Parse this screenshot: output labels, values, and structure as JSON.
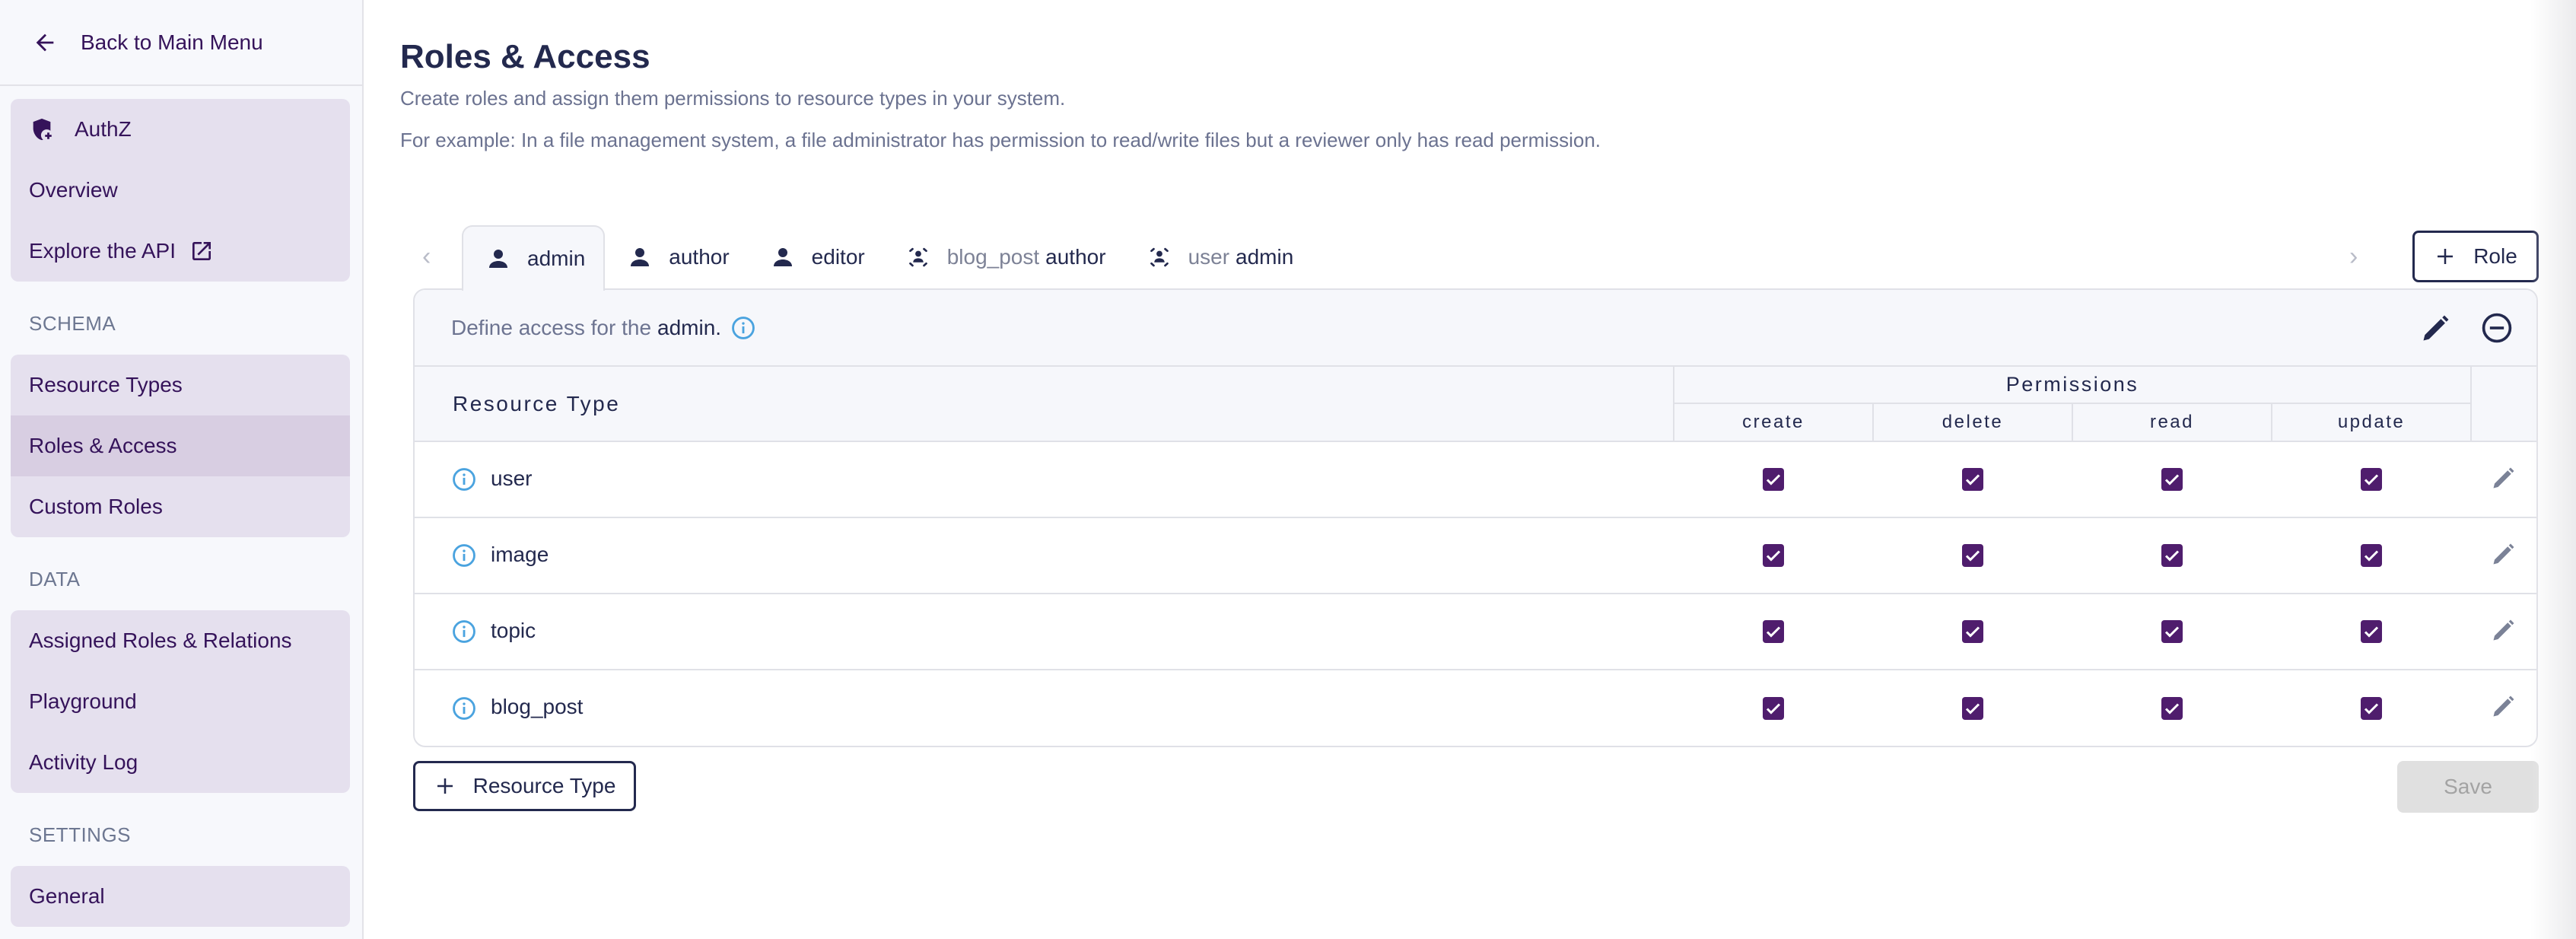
{
  "sidebar": {
    "back_label": "Back to Main Menu",
    "product": {
      "title": "AuthZ",
      "items": [
        "Overview",
        "Explore the API"
      ]
    },
    "sections": [
      {
        "label": "SCHEMA",
        "items": [
          "Resource Types",
          "Roles & Access",
          "Custom Roles"
        ],
        "active": "Roles & Access"
      },
      {
        "label": "DATA",
        "items": [
          "Assigned Roles & Relations",
          "Playground",
          "Activity Log"
        ]
      },
      {
        "label": "SETTINGS",
        "items": [
          "General"
        ]
      }
    ]
  },
  "header": {
    "title": "Roles & Access",
    "subtitle": "Create roles and assign them permissions to resource types in your system.",
    "example": "For example: In a file management system, a file administrator has permission to read/write files but a reviewer only has read permission."
  },
  "tabs": [
    {
      "icon": "person-icon",
      "prefix": "",
      "label": "admin",
      "active": true
    },
    {
      "icon": "person-icon",
      "prefix": "",
      "label": "author"
    },
    {
      "icon": "person-icon",
      "prefix": "",
      "label": "editor"
    },
    {
      "icon": "relation-role-icon",
      "prefix": "blog_post",
      "label": "author"
    },
    {
      "icon": "relation-role-icon",
      "prefix": "user",
      "label": "admin"
    }
  ],
  "add_role_label": "Role",
  "card": {
    "define_prefix": "Define access for the",
    "role_name": "admin",
    "role_suffix": ".",
    "col_resource": "Resource Type",
    "col_permissions": "Permissions",
    "permissions": [
      "create",
      "delete",
      "read",
      "update"
    ],
    "rows": [
      {
        "name": "user",
        "checked": [
          true,
          true,
          true,
          true
        ]
      },
      {
        "name": "image",
        "checked": [
          true,
          true,
          true,
          true
        ]
      },
      {
        "name": "topic",
        "checked": [
          true,
          true,
          true,
          true
        ]
      },
      {
        "name": "blog_post",
        "checked": [
          true,
          true,
          true,
          true
        ]
      }
    ]
  },
  "add_resource_type_label": "Resource Type",
  "save_label": "Save",
  "colors": {
    "brand_dark": "#35135a",
    "accent_checkbox": "#4f1d6d",
    "info_blue": "#4aa3df",
    "text_primary": "#23294e",
    "text_muted": "#6b7290"
  }
}
